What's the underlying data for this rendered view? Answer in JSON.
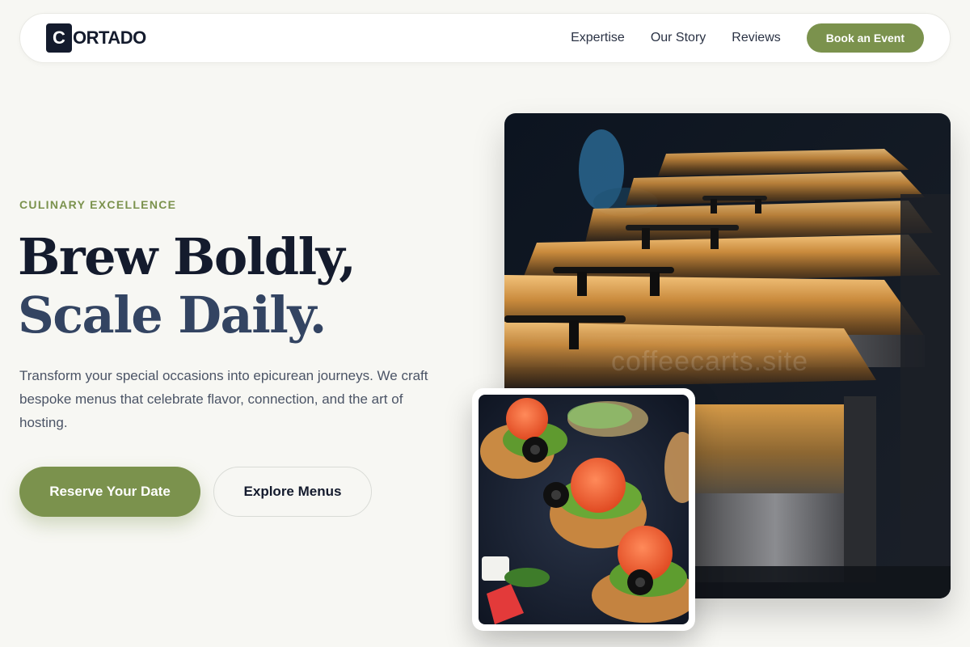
{
  "brand": {
    "mark": "C",
    "rest": "ORTADO"
  },
  "nav": {
    "links": [
      "Expertise",
      "Our Story",
      "Reviews"
    ],
    "cta": "Book an Event"
  },
  "hero": {
    "eyebrow": "CULINARY EXCELLENCE",
    "headline_line1": "Brew Boldly,",
    "headline_line2": "Scale Daily.",
    "lede": "Transform your special occasions into epicurean journeys. We craft bespoke menus that celebrate flavor, connection, and the art of hosting.",
    "primary_button": "Reserve Your Date",
    "secondary_button": "Explore Menus"
  },
  "images": {
    "main_alt": "Row of polished chafing dishes at a catered buffet",
    "food_alt": "Bruschetta topped with smoked salmon, olives and microgreens",
    "watermark": "coffeecarts.site"
  },
  "colors": {
    "accent": "#7b924d",
    "ink": "#141b2d",
    "ink_soft": "#334462",
    "background": "#f7f7f3"
  },
  "icons": {
    "logo": "letter-c-logo-icon"
  }
}
